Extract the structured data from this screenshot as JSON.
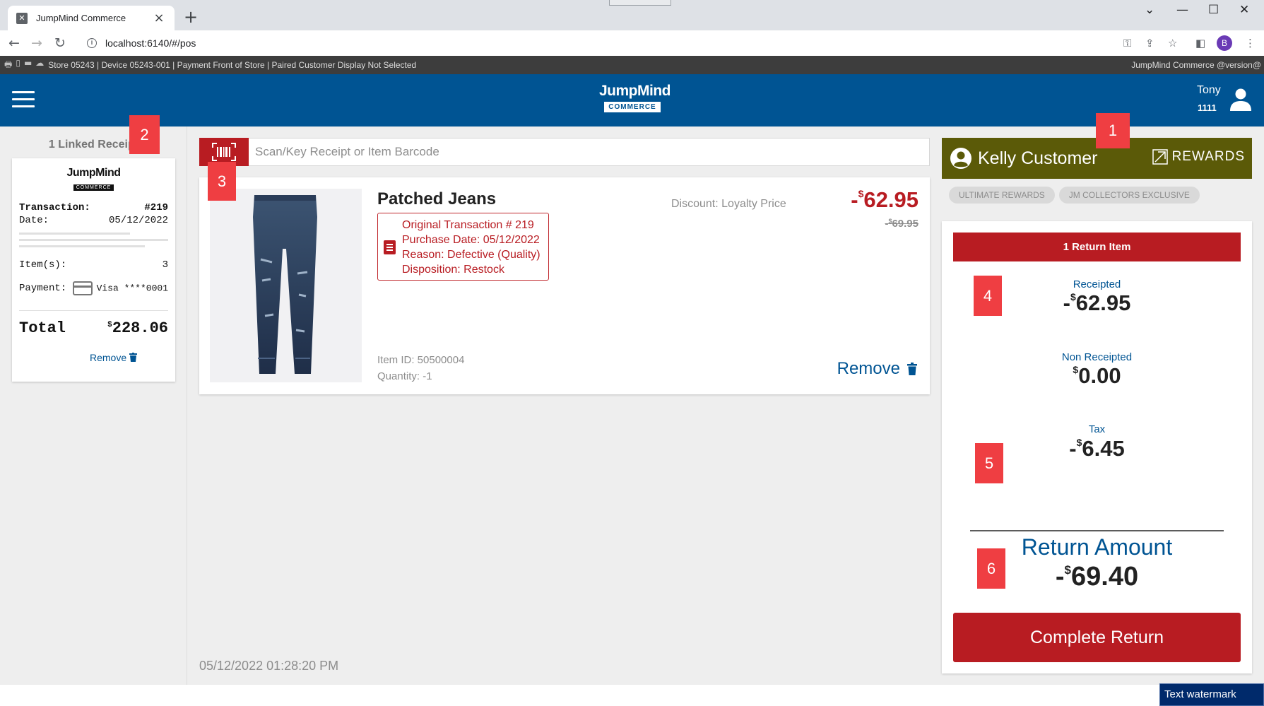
{
  "browser": {
    "tab_title": "JumpMind Commerce",
    "url": "localhost:6140/#/pos",
    "profile_initial": "B"
  },
  "status_bar": {
    "text": "Store 05243 | Device 05243-001 | Payment Front of Store | Paired Customer Display Not Selected",
    "right_text": "JumpMind Commerce @version@"
  },
  "header": {
    "brand_name": "JumpMind",
    "brand_sub": "COMMERCE",
    "user_name": "Tony",
    "user_id": "1111"
  },
  "linked_receipts": {
    "title": "1 Linked Receipt",
    "logo_name": "JumpMind",
    "logo_sub": "COMMERCE",
    "transaction_label": "Transaction:",
    "transaction_value": "#219",
    "date_label": "Date:",
    "date_value": "05/12/2022",
    "items_label": "Item(s):",
    "items_value": "3",
    "payment_label": "Payment:",
    "payment_value": "Visa ****0001",
    "total_label": "Total",
    "total_currency": "$",
    "total_value": "228.06",
    "remove_label": "Remove"
  },
  "scan": {
    "placeholder": "Scan/Key Receipt or Item Barcode"
  },
  "item": {
    "name": "Patched Jeans",
    "original_transaction": "Original Transaction # 219",
    "purchase_date": "Purchase Date: 05/12/2022",
    "reason": "Reason: Defective (Quality)",
    "disposition": "Disposition: Restock",
    "discount": "Discount: Loyalty Price",
    "price_sign": "-",
    "price_currency": "$",
    "price": "62.95",
    "original_price_sign": "-",
    "original_price_currency": "$",
    "original_price": "69.95",
    "item_id": "Item ID: 50500004",
    "quantity": "Quantity: -1",
    "remove_label": "Remove"
  },
  "datetime": "05/12/2022 01:28:20 PM",
  "customer": {
    "name": "Kelly Customer",
    "rewards_label": "REWARDS",
    "tags": [
      "ULTIMATE REWARDS",
      "JM COLLECTORS EXCLUSIVE"
    ]
  },
  "summary": {
    "header": "1 Return Item",
    "receipted_label": "Receipted",
    "receipted_sign": "-",
    "receipted_currency": "$",
    "receipted_value": "62.95",
    "non_receipted_label": "Non Receipted",
    "non_receipted_currency": "$",
    "non_receipted_value": "0.00",
    "tax_label": "Tax",
    "tax_sign": "-",
    "tax_currency": "$",
    "tax_value": "6.45",
    "return_amount_label": "Return Amount",
    "return_amount_sign": "-",
    "return_amount_currency": "$",
    "return_amount_value": "69.40",
    "complete_button": "Complete Return"
  },
  "markers": [
    "1",
    "2",
    "3",
    "4",
    "5",
    "6"
  ],
  "watermark": "Text watermark",
  "colors": {
    "header_blue": "#005493",
    "accent_red": "#b81c22",
    "customer_olive": "#5b5a08",
    "marker_red": "#ef3e42"
  }
}
